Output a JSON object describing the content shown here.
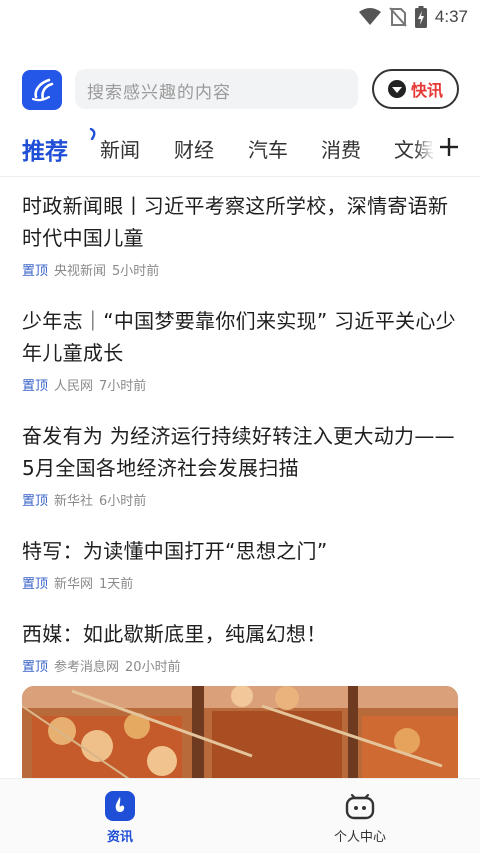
{
  "status_bar": {
    "time": "4:37",
    "icons": [
      "wifi-icon",
      "no-sim-icon",
      "battery-charging-icon"
    ]
  },
  "header": {
    "logo_icon": "app-logo-icon",
    "search_placeholder": "搜索感兴趣的内容",
    "express_label": "快讯",
    "brand_color": "#1f4fd6"
  },
  "tabs": [
    {
      "label": "推荐",
      "active": true
    },
    {
      "label": "新闻",
      "active": false
    },
    {
      "label": "财经",
      "active": false
    },
    {
      "label": "汽车",
      "active": false
    },
    {
      "label": "消费",
      "active": false
    },
    {
      "label": "文娱",
      "active": false
    }
  ],
  "tabs_more_icon": "plus-icon",
  "news": [
    {
      "title": "时政新闻眼丨习近平考察这所学校，深情寄语新时代中国儿童",
      "pin": "置顶",
      "source": "央视新闻",
      "time": "5小时前"
    },
    {
      "title": "少年志｜“中国梦要靠你们来实现” 习近平关心少年儿童成长",
      "pin": "置顶",
      "source": "人民网",
      "time": "7小时前"
    },
    {
      "title": "奋发有为 为经济运行持续好转注入更大动力——5月全国各地经济社会发展扫描",
      "pin": "置顶",
      "source": "新华社",
      "time": "6小时前"
    },
    {
      "title": "特写：为读懂中国打开“思想之门”",
      "pin": "置顶",
      "source": "新华网",
      "time": "1天前"
    },
    {
      "title": "西媒：如此歇斯底里，纯属幻想！",
      "pin": "置顶",
      "source": "参考消息网",
      "time": "20小时前"
    }
  ],
  "bottom_nav": [
    {
      "label": "资讯",
      "icon": "news-icon",
      "active": true
    },
    {
      "label": "个人中心",
      "icon": "profile-icon",
      "active": false
    }
  ]
}
